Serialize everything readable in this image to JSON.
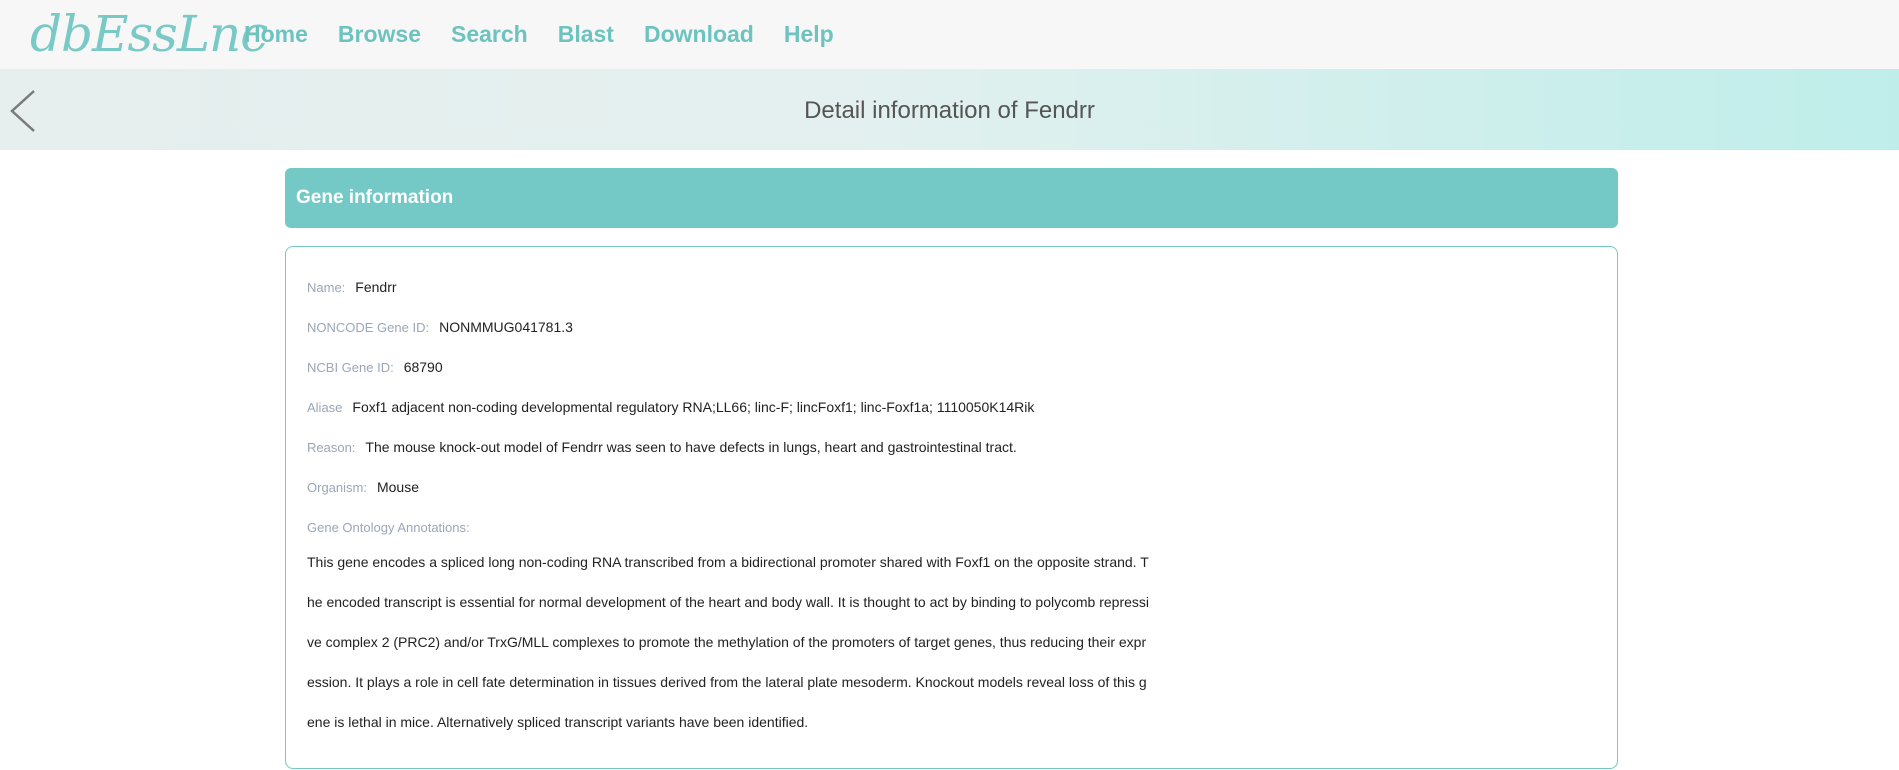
{
  "header": {
    "logo_text": "dbEssLnc",
    "nav": [
      {
        "label": "Home"
      },
      {
        "label": "Browse"
      },
      {
        "label": "Search"
      },
      {
        "label": "Blast"
      },
      {
        "label": "Download"
      },
      {
        "label": "Help"
      }
    ]
  },
  "banner": {
    "title": "Detail information of Fendrr"
  },
  "section": {
    "title": "Gene information"
  },
  "gene": {
    "name_label": "Name:",
    "name_value": "Fendrr",
    "noncode_label": "NONCODE Gene ID:",
    "noncode_value": "NONMMUG041781.3",
    "ncbi_label": "NCBI Gene ID:",
    "ncbi_value": "68790",
    "aliase_label": "Aliase",
    "aliase_value": "Foxf1 adjacent non-coding developmental regulatory RNA;LL66; linc-F; lincFoxf1; linc-Foxf1a; 1110050K14Rik",
    "reason_label": "Reason:",
    "reason_value": "The mouse knock-out model of Fendrr was seen to have defects in lungs, heart and gastrointestinal tract.",
    "organism_label": "Organism:",
    "organism_value": "Mouse",
    "go_label": "Gene Ontology Annotations:",
    "go_lines": [
      "This gene encodes a spliced long non-coding RNA transcribed from a bidirectional promoter shared with Foxf1 on the opposite strand. T",
      "he encoded transcript is essential for normal development of the heart and body wall. It is thought to act by binding to polycomb repressi",
      "ve complex 2 (PRC2) and/or TrxG/MLL complexes to promote the methylation of the promoters of target genes, thus reducing their expr",
      "ession. It plays a role in cell fate determination in tissues derived from the lateral plate mesoderm. Knockout models reveal loss of this g",
      "ene is lethal in mice. Alternatively spliced transcript variants have been identified."
    ]
  },
  "colors": {
    "accent": "#74c9c6",
    "nav_text": "#6cc3c0",
    "label_text": "#9aa7b8"
  }
}
